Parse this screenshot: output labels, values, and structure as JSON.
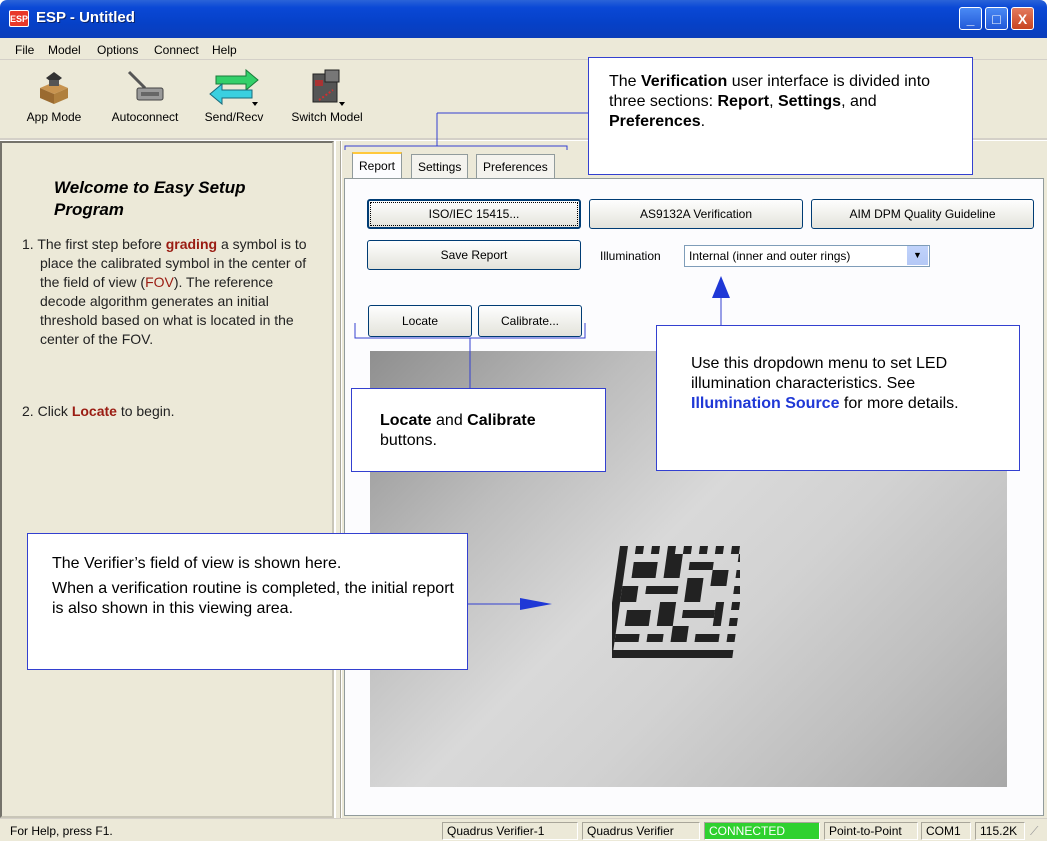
{
  "window": {
    "icon_text": "ESP",
    "title": "ESP - Untitled",
    "minimize": "_",
    "maximize": "□",
    "close": "X"
  },
  "menu": [
    "File",
    "Model",
    "Options",
    "Connect",
    "Help"
  ],
  "toolbar": [
    {
      "label": "App Mode",
      "icon": "app-mode-icon"
    },
    {
      "label": "Autoconnect",
      "icon": "autoconnect-icon"
    },
    {
      "label": "Send/Recv",
      "icon": "send-recv-icon"
    },
    {
      "label": "Switch Model",
      "icon": "switch-model-icon"
    }
  ],
  "left": {
    "title": "Welcome to Easy Setup Program",
    "step1": {
      "n": "1. ",
      "a": "The first step before ",
      "grading": "grading",
      "b": " a symbol is to place the calibrated symbol in the center of the field of view (",
      "fov": "FOV",
      "c": "). The reference decode algorithm generates an initial threshold based on what is located in the center of the FOV."
    },
    "step2": {
      "n": "2. ",
      "a": "Click ",
      "locate": "Locate",
      "b": " to begin."
    }
  },
  "tabs": [
    "Report",
    "Settings",
    "Preferences"
  ],
  "report": {
    "iso_button": "ISO/IEC 15415...",
    "as_button": "AS9132A Verification",
    "aim_button": "AIM DPM Quality Guideline",
    "save_button": "Save Report",
    "illumination_label": "Illumination",
    "illumination_value": "Internal (inner and outer rings)",
    "locate_button": "Locate",
    "calibrate_button": "Calibrate..."
  },
  "callouts": {
    "tabs": {
      "a": "The ",
      "b1": "Verification",
      "c": " user interface is divided into three sections: ",
      "b2": "Report",
      "d": ", ",
      "b3": "Settings",
      "e": ", and ",
      "b4": "Preferences",
      "f": "."
    },
    "dropdown": {
      "a": "Use this dropdown menu to set LED illumination characteristics. See ",
      "link": "Illumination Source",
      "b": " for more details."
    },
    "buttons": {
      "b1": "Locate",
      "a": " and ",
      "b2": "Calibrate",
      "c": " buttons."
    },
    "fov": {
      "line1": "The Verifier’s field of view is shown here.",
      "line2": "When a verification routine is completed, the initial report is also shown in this viewing area."
    }
  },
  "statusbar": {
    "help": "For Help, press F1.",
    "model1": "Quadrus Verifier-1",
    "model2": "Quadrus Verifier",
    "status": "CONNECTED",
    "mode": "Point-to-Point",
    "port": "COM1",
    "baud": "115.2K"
  },
  "colors": {
    "connected": "#2fd12f",
    "callout_border": "#3340d0",
    "highlight": "#9a1c12",
    "link": "#1f38d6"
  }
}
